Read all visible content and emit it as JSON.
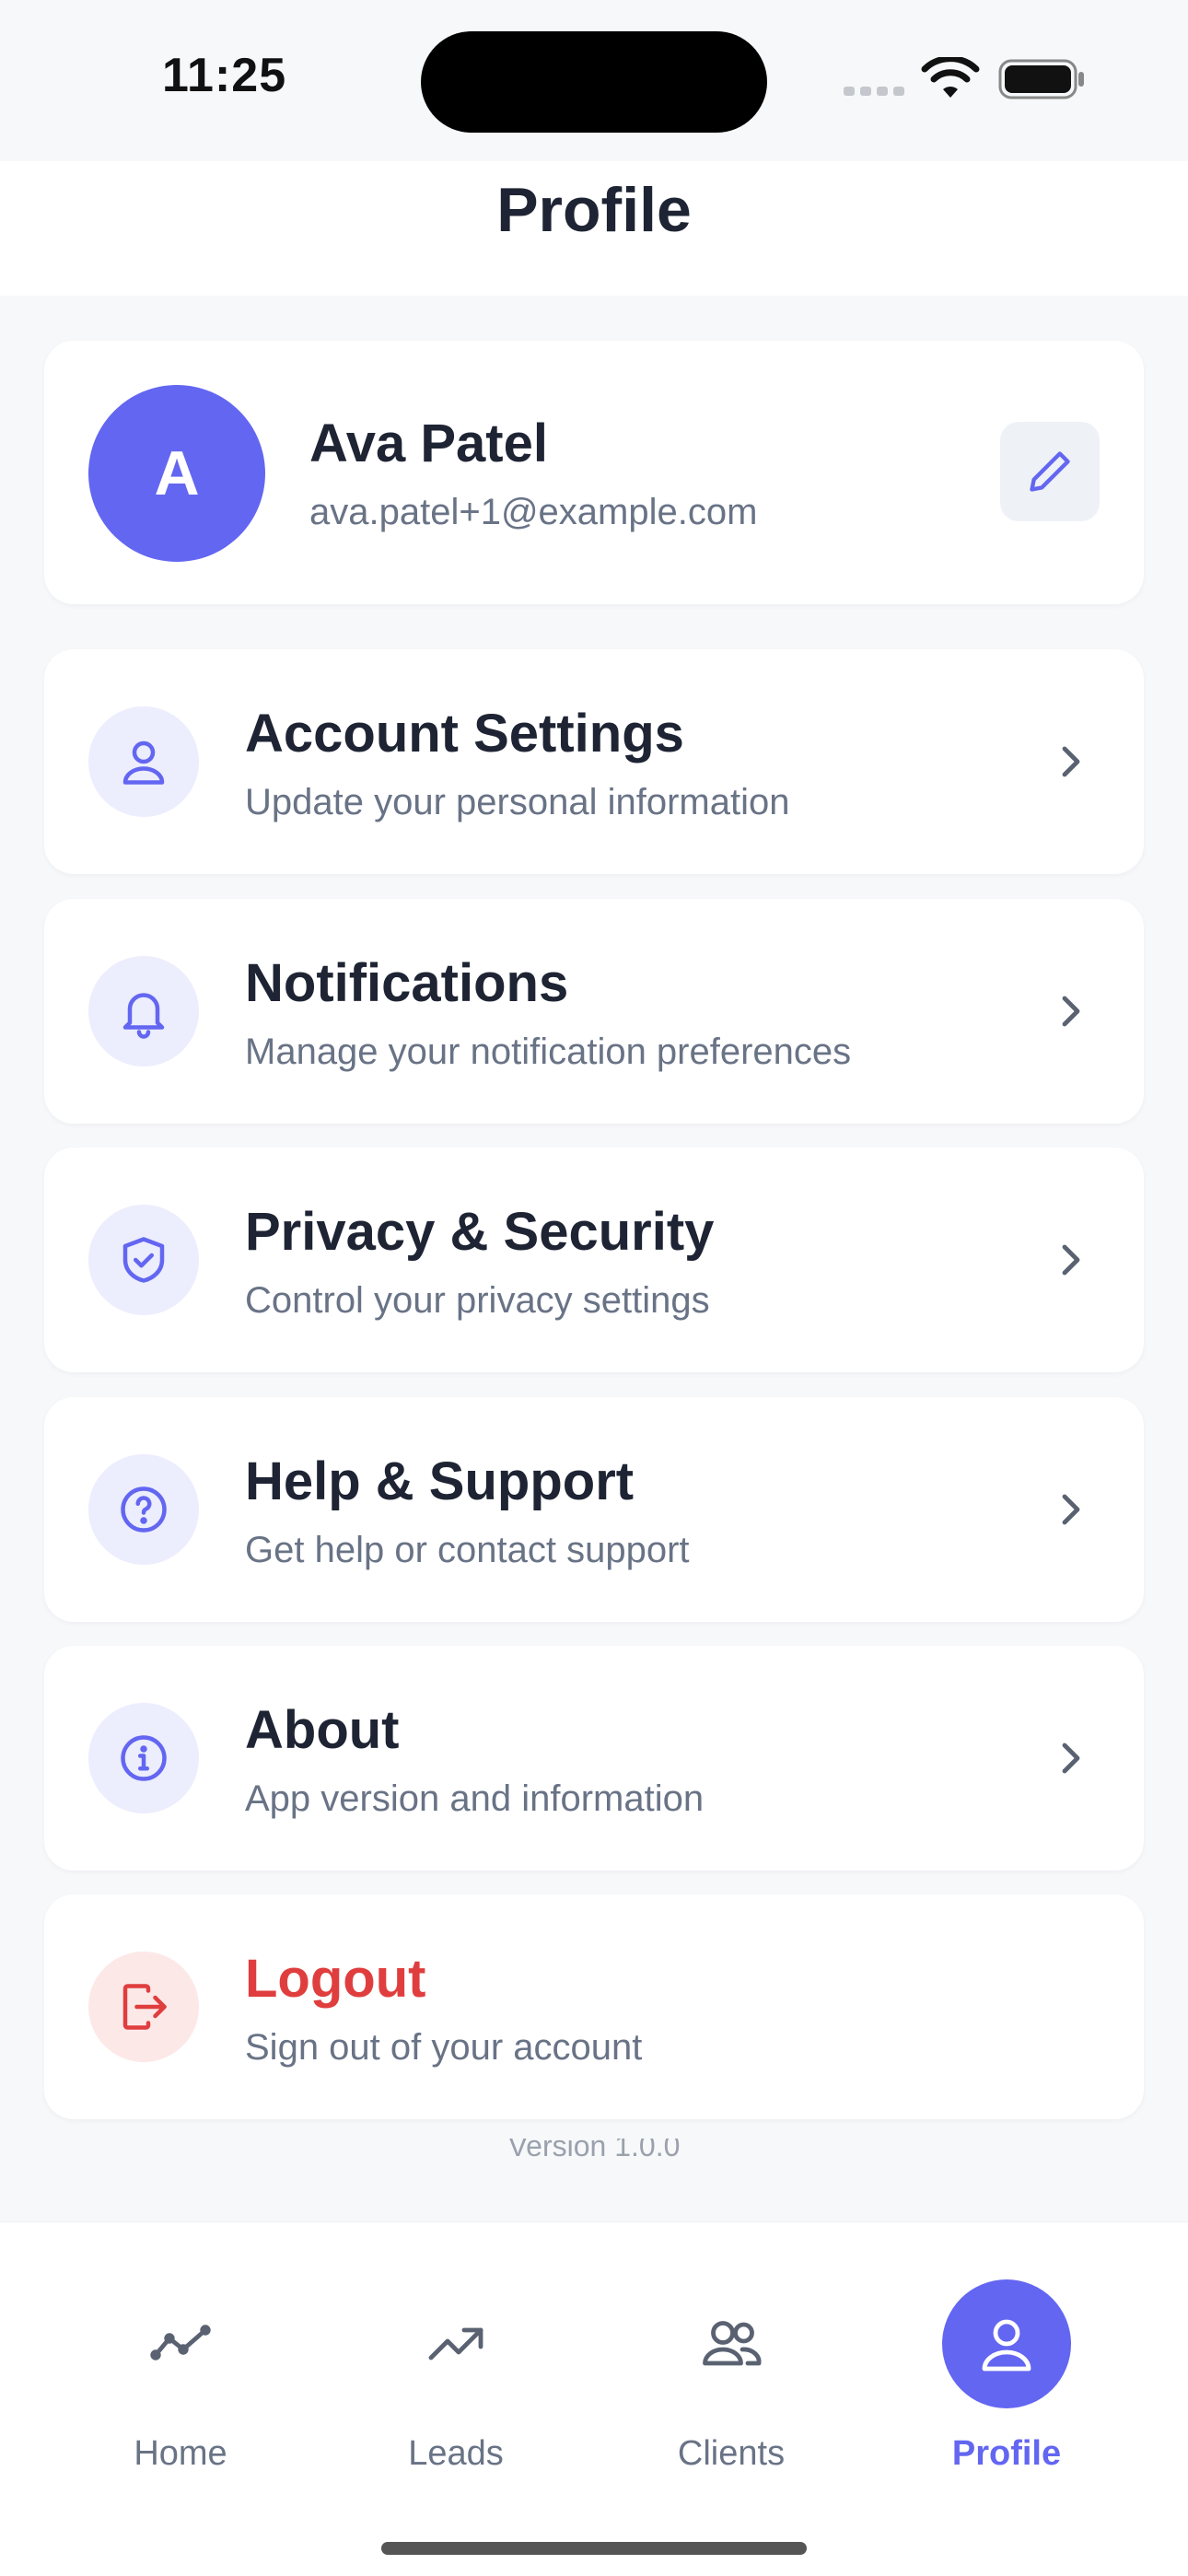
{
  "status_bar": {
    "time": "11:25"
  },
  "header": {
    "title": "Profile"
  },
  "profile": {
    "initial": "A",
    "name": "Ava Patel",
    "email": "ava.patel+1@example.com"
  },
  "menu": [
    {
      "title": "Account Settings",
      "subtitle": "Update your personal information",
      "icon": "user-icon"
    },
    {
      "title": "Notifications",
      "subtitle": "Manage your notification preferences",
      "icon": "bell-icon"
    },
    {
      "title": "Privacy & Security",
      "subtitle": "Control your privacy settings",
      "icon": "shield-check-icon"
    },
    {
      "title": "Help & Support",
      "subtitle": "Get help or contact support",
      "icon": "help-circle-icon"
    },
    {
      "title": "About",
      "subtitle": "App version and information",
      "icon": "info-icon"
    },
    {
      "title": "Logout",
      "subtitle": "Sign out of your account",
      "icon": "logout-icon"
    }
  ],
  "version_text": "Version 1.0.0",
  "tabs": [
    {
      "label": "Home",
      "icon": "activity-icon"
    },
    {
      "label": "Leads",
      "icon": "trending-up-icon"
    },
    {
      "label": "Clients",
      "icon": "users-icon"
    },
    {
      "label": "Profile",
      "icon": "user-icon",
      "active": true
    }
  ],
  "colors": {
    "accent": "#6366f1",
    "danger": "#e03e3e",
    "icon_bg": "#ecedfd"
  }
}
